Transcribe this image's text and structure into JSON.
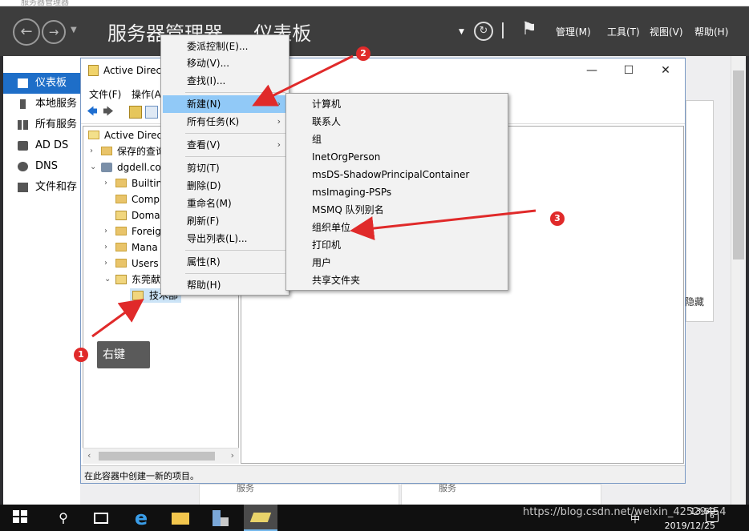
{
  "server_manager": {
    "title": "服务器管理器",
    "heading": "服务器管理器",
    "breadcrumb_sep": "▸",
    "breadcrumb_page": "仪表板",
    "menus": [
      "管理(M)",
      "工具(T)",
      "视图(V)",
      "帮助(H)"
    ],
    "sidebar": [
      {
        "label": "仪表板",
        "icon": "dashboard-icon"
      },
      {
        "label": "本地服务",
        "icon": "server-icon"
      },
      {
        "label": "所有服务",
        "icon": "servers-icon"
      },
      {
        "label": "AD DS",
        "icon": "adds-icon"
      },
      {
        "label": "DNS",
        "icon": "dns-icon"
      },
      {
        "label": "文件和存",
        "icon": "file-storage-icon"
      }
    ],
    "bg_texts": [
      "服务",
      "服务",
      "隐藏"
    ]
  },
  "aduc": {
    "title": "Active Direct",
    "menus": [
      "文件(F)",
      "操作(A"
    ],
    "tree": {
      "root": "Active Direct",
      "saved_queries": "保存的查询",
      "domain": "dgdell.co",
      "children": [
        "Builtin",
        "Comp",
        "Doma",
        "Foreig",
        "Mana",
        "Users",
        "东莞献"
      ],
      "selected": "技术部"
    },
    "status": "在此容器中创建一新的项目。"
  },
  "context_menu": {
    "items": [
      {
        "label": "委派控制(E)..."
      },
      {
        "label": "移动(V)..."
      },
      {
        "label": "查找(I)..."
      },
      {
        "label": "新建(N)",
        "submenu": true,
        "highlight": true
      },
      {
        "label": "所有任务(K)",
        "submenu": true
      },
      {
        "label": "查看(V)",
        "submenu": true
      },
      {
        "label": "剪切(T)"
      },
      {
        "label": "删除(D)"
      },
      {
        "label": "重命名(M)"
      },
      {
        "label": "刷新(F)"
      },
      {
        "label": "导出列表(L)..."
      },
      {
        "label": "属性(R)"
      },
      {
        "label": "帮助(H)"
      }
    ]
  },
  "new_submenu": {
    "items": [
      "计算机",
      "联系人",
      "组",
      "InetOrgPerson",
      "msDS-ShadowPrincipalContainer",
      "msImaging-PSPs",
      "MSMQ 队列别名",
      "组织单位",
      "打印机",
      "用户",
      "共享文件夹"
    ]
  },
  "annotations": {
    "step1": "1",
    "step1_label": "右键",
    "step2": "2",
    "step3": "3",
    "accent": "#e02a2a"
  },
  "taskbar": {
    "time": "13:59",
    "date": "2019/12/25",
    "notification_count": "6",
    "watermark": "https://blog.csdn.net/weixin_42529454",
    "ime": "中"
  }
}
